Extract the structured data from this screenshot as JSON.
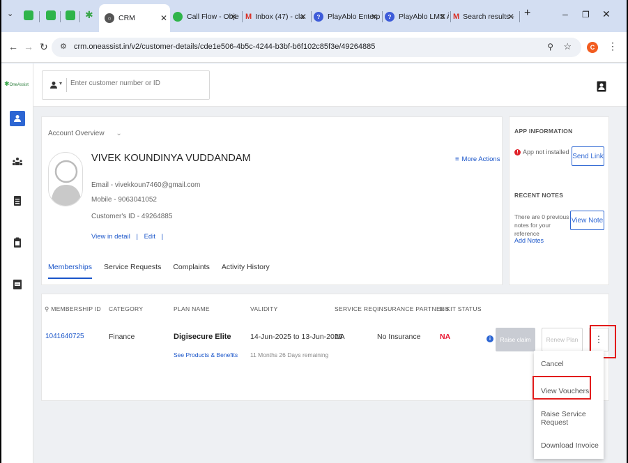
{
  "browser": {
    "tabs": [
      {
        "label": "CRM",
        "icon": "globe-icon"
      },
      {
        "label": "Call Flow - Obje",
        "icon": "call-flow-icon"
      },
      {
        "label": "Inbox (47) - cla",
        "icon": "gmail-icon"
      },
      {
        "label": "PlayAblo Enterp",
        "icon": "playablo-icon"
      },
      {
        "label": "PlayAblo LMS Â",
        "icon": "playablo-icon"
      },
      {
        "label": "Search results -",
        "icon": "gmail-icon"
      }
    ],
    "new_tab": "+",
    "url": "crm.oneassist.in/v2/customer-details/cde1e506-4b5c-4244-b3bf-b6f102c85f3e/49264885",
    "profile_initial": "C"
  },
  "app": {
    "logo_text": "OneAssist",
    "search_placeholder": "Enter customer number or ID"
  },
  "account": {
    "section_label": "Account Overview",
    "name": "VIVEK KOUNDINYA VUDDANDAM",
    "email": "Email - vivekkoun7460@gmail.com",
    "mobile": "Mobile - 9063041052",
    "customer_id": "Customer's ID - 49264885",
    "view_detail": "View in detail",
    "edit": "Edit",
    "divider": "|",
    "more_actions": "More Actions",
    "tabs": [
      "Memberships",
      "Service Requests",
      "Complaints",
      "Activity History"
    ]
  },
  "app_info": {
    "title": "APP INFORMATION",
    "status": "App not installed",
    "send_link": "Send Link",
    "notes_title": "RECENT NOTES",
    "notes_text": "There are 0 previous notes for your reference",
    "view_note": "View Note",
    "add_notes": "Add Notes"
  },
  "table": {
    "headers": [
      "MEMBERSHIP ID",
      "CATEGORY",
      "PLAN NAME",
      "VALIDITY",
      "SERVICE REQ.",
      "INSURANCE PARTNERS",
      "E-KIT STATUS"
    ],
    "row": {
      "membership_id": "1041640725",
      "category": "Finance",
      "plan_name": "Digisecure Elite",
      "plan_link": "See Products & Benefits",
      "validity": "14-Jun-2025 to 13-Jun-2026",
      "remaining": "11 Months 26 Days remaining",
      "service_req": "NA",
      "insurance": "No Insurance",
      "ekit": "NA",
      "raise_claim": "Raise claim",
      "renew_plan": "Renew Plan"
    }
  },
  "menu": {
    "items": [
      "Cancel",
      "View Vouchers",
      "Raise Service Request",
      "Download Invoice"
    ]
  },
  "colors": {
    "accent": "#1a55c9",
    "ekit_na": "#e8112d",
    "highlight": "#e21b1b"
  }
}
